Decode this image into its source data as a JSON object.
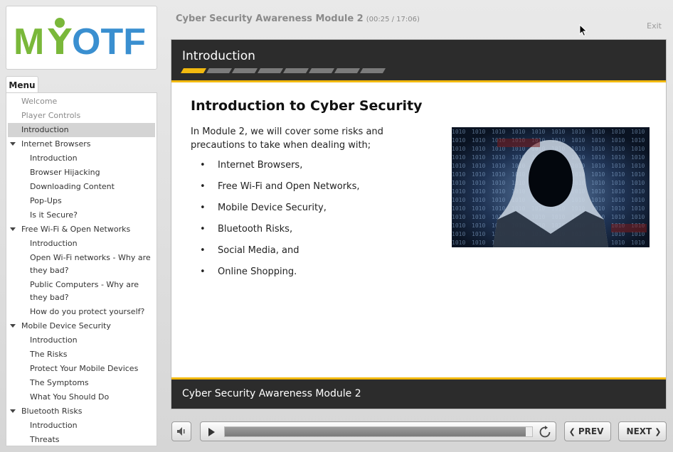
{
  "logo": {
    "text": "MYOTF",
    "colors": {
      "green": "#7ab83a",
      "blue": "#3a8fd0"
    }
  },
  "header": {
    "title": "Cyber Security Awareness Module 2",
    "time": "(00:25 / 17:06)",
    "exit_label": "Exit"
  },
  "menu": {
    "tab_label": "Menu",
    "items": [
      {
        "label": "Welcome",
        "type": "top",
        "dim": true
      },
      {
        "label": "Player Controls",
        "type": "top",
        "dim": true
      },
      {
        "label": "Introduction",
        "type": "top",
        "active": true
      },
      {
        "label": "Internet Browsers",
        "type": "section"
      },
      {
        "label": "Introduction",
        "type": "child"
      },
      {
        "label": "Browser Hijacking",
        "type": "child"
      },
      {
        "label": "Downloading Content",
        "type": "child"
      },
      {
        "label": "Pop-Ups",
        "type": "child"
      },
      {
        "label": "Is it Secure?",
        "type": "child"
      },
      {
        "label": "Free Wi-Fi & Open Networks",
        "type": "section"
      },
      {
        "label": "Introduction",
        "type": "child"
      },
      {
        "label": "Open Wi-Fi networks - Why are they bad?",
        "type": "child"
      },
      {
        "label": "Public Computers - Why are they bad?",
        "type": "child"
      },
      {
        "label": "How do you protect yourself?",
        "type": "child"
      },
      {
        "label": "Mobile Device Security",
        "type": "section"
      },
      {
        "label": "Introduction",
        "type": "child"
      },
      {
        "label": "The Risks",
        "type": "child"
      },
      {
        "label": "Protect Your Mobile Devices",
        "type": "child"
      },
      {
        "label": "The Symptoms",
        "type": "child"
      },
      {
        "label": "What You Should Do",
        "type": "child"
      },
      {
        "label": "Bluetooth Risks",
        "type": "section"
      },
      {
        "label": "Introduction",
        "type": "child"
      },
      {
        "label": "Threats",
        "type": "child"
      }
    ]
  },
  "slide": {
    "header_title": "Introduction",
    "progress": {
      "total_segments": 8,
      "completed_segments": 1
    },
    "heading": "Introduction to Cyber Security",
    "intro": "In Module 2, we will cover some risks and precautions to take when dealing with;",
    "bullets": [
      "Internet Browsers,",
      "Free Wi-Fi and Open Networks,",
      "Mobile Device Security,",
      "Bluetooth Risks,",
      "Social Media, and",
      "Online Shopping."
    ],
    "footer_title": "Cyber Security Awareness Module 2"
  },
  "player": {
    "prev_label": "PREV",
    "next_label": "NEXT",
    "seek_progress_fraction": 0.98
  }
}
